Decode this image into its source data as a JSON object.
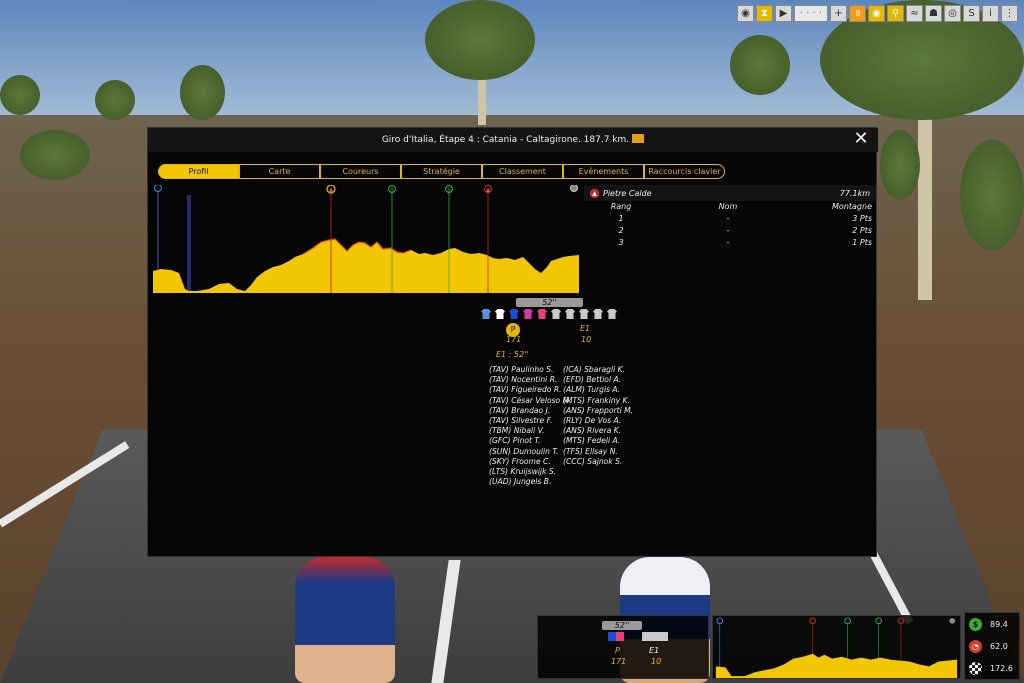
{
  "toolbar": {
    "buttons": [
      "user-icon",
      "hourglass-icon",
      "play-icon",
      "speed-slider",
      "plus-icon",
      "pause-icon",
      "eye-icon",
      "bike-icon",
      "wind-icon",
      "team-icon",
      "target-icon",
      "ai-icon",
      "info-icon",
      "menu-icon"
    ]
  },
  "modal": {
    "title": "Giro d'Italia, Étape 4 : Catania - Caltagirone. 187.7 km.",
    "close_label": "✕"
  },
  "tabs": [
    {
      "label": "Profil",
      "active": true
    },
    {
      "label": "Carte",
      "active": false
    },
    {
      "label": "Coureurs",
      "active": false
    },
    {
      "label": "Stratégie",
      "active": false
    },
    {
      "label": "Classement",
      "active": false
    },
    {
      "label": "Evénements",
      "active": false
    },
    {
      "label": "Raccourcis clavier",
      "active": false
    }
  ],
  "profile": {
    "markers": [
      {
        "type": "start",
        "color": "#4a7bd1",
        "symbol": "◎"
      },
      {
        "type": "kom",
        "color": "#c62828",
        "symbol": "A"
      },
      {
        "type": "sprint",
        "color": "#3aa83a",
        "symbol": "S"
      },
      {
        "type": "sprint",
        "color": "#3aa83a",
        "symbol": "S"
      },
      {
        "type": "kom",
        "color": "#c62828",
        "symbol": "A"
      }
    ],
    "fill_color": "#f2c600"
  },
  "points_table": {
    "climb_name": "Pietre Calde",
    "climb_km": "77.1km",
    "headers": [
      "Rang",
      "Nom",
      "Montagne"
    ],
    "rows": [
      [
        "1",
        "-",
        "3 Pts"
      ],
      [
        "2",
        "-",
        "2 Pts"
      ],
      [
        "3",
        "-",
        "1 Pts"
      ]
    ]
  },
  "gap": {
    "time": "52''",
    "group_p_label": "P",
    "group_p_count": "171",
    "group_e1_label": "E1",
    "group_e1_count": "10",
    "e1_gap": "E1 : 52''",
    "jersey_colors": [
      "#5f8fd8",
      "#ffffff",
      "#1f4bd6",
      "#d23aa0",
      "#e8407a",
      "#c9c9c9",
      "#c9c9c9",
      "#c9c9c9",
      "#c9c9c9",
      "#c9c9c9"
    ]
  },
  "riders_left": [
    "(TAV) Paulinho S.",
    "(TAV) Nocentini R.",
    "(TAV) Figueiredo R.",
    "(TAV) César Veloso M.",
    "(TAV) Brandao J.",
    "(TAV) Silvestre F.",
    "(TBM) Nibali V.",
    "(GFC) Pinot T.",
    "(SUN) Dumoulin T.",
    "(SKY) Froome C.",
    "(LTS) Kruijswijk S.",
    "(UAD) Jungels B."
  ],
  "riders_right": [
    "(ICA) Sbaragli K.",
    "(EFD) Bettiol A.",
    "(ALM) Turgis A.",
    "(MTS) Frankiny K.",
    "(ANS) Frapporti M.",
    "(RLY) De Vos A.",
    "(ANS) Rivera K.",
    "(MTS) Fedeli A.",
    "(TFS) Ellsay N.",
    "(CCC) Sajnok S."
  ],
  "mini_gap": {
    "time": "52''",
    "p_label": "P",
    "p_count": "171",
    "e1_label": "E1",
    "e1_count": "10"
  },
  "stats": {
    "money": "89.4",
    "speed": "62.0",
    "distance": "172.6"
  }
}
